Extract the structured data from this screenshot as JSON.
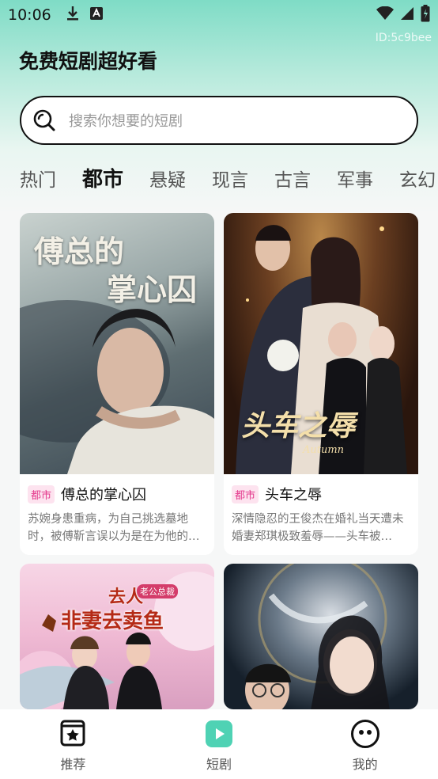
{
  "status_bar": {
    "time": "10:06",
    "left_icons": [
      "download-icon",
      "app-notification-icon"
    ],
    "right_icons": [
      "wifi-icon",
      "cell-signal-icon",
      "battery-icon"
    ]
  },
  "watermark": "ID:5c9bee",
  "page_title": "免费短剧超好看",
  "search": {
    "placeholder": "搜索你想要的短剧",
    "icon": "search-icon"
  },
  "tabs": [
    {
      "label": "热门",
      "active": false
    },
    {
      "label": "都市",
      "active": true
    },
    {
      "label": "悬疑",
      "active": false
    },
    {
      "label": "现言",
      "active": false
    },
    {
      "label": "古言",
      "active": false
    },
    {
      "label": "军事",
      "active": false
    },
    {
      "label": "玄幻",
      "active": false
    }
  ],
  "cards": [
    {
      "genre": "都市",
      "title": "傅总的掌心囚",
      "description": "苏婉身患重病，为自己挑选墓地时，被傅靳言误以为是在为他的…",
      "poster_text": [
        "傅总的",
        "掌心囚"
      ]
    },
    {
      "genre": "都市",
      "title": "头车之辱",
      "description": "深情隐忍的王俊杰在婚礼当天遭未婚妻郑琪极致羞辱——头车被…",
      "poster_text": [
        "头车之辱",
        "Autumn"
      ]
    },
    {
      "genre": "",
      "title": "",
      "description": "",
      "poster_text": [
        "去人",
        "非妻去卖鱼",
        "老公总裁"
      ]
    },
    {
      "genre": "",
      "title": "",
      "description": "",
      "poster_text": []
    }
  ],
  "bottom_nav": [
    {
      "label": "推荐",
      "icon": "recommend-star-icon",
      "active": false
    },
    {
      "label": "短剧",
      "icon": "play-icon",
      "active": true
    },
    {
      "label": "我的",
      "icon": "profile-face-icon",
      "active": false
    }
  ],
  "colors": {
    "accent": "#2ec5a4",
    "badge_text": "#e43b8e",
    "badge_bg": "#fde3ef",
    "header_gradient_top": "#7fdcc6"
  }
}
